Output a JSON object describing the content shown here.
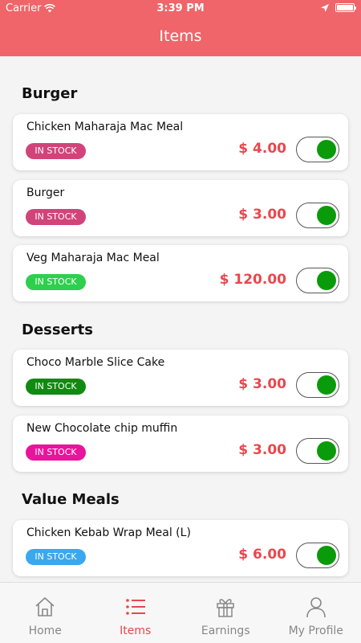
{
  "status_bar": {
    "carrier": "Carrier",
    "time": "3:39 PM"
  },
  "header": {
    "title": "Items"
  },
  "colors": {
    "accent": "#ef6569",
    "price": "#e9474d",
    "toggle_on": "#0a9b0a"
  },
  "sections": [
    {
      "title": "Burger",
      "items": [
        {
          "name": "Chicken Maharaja Mac Meal",
          "badge": "IN STOCK",
          "badge_color": "#d1447a",
          "price": "$ 4.00",
          "enabled": true
        },
        {
          "name": "Burger",
          "badge": "IN STOCK",
          "badge_color": "#d1447a",
          "price": "$ 3.00",
          "enabled": true
        },
        {
          "name": "Veg Maharaja Mac Meal",
          "badge": "IN STOCK",
          "badge_color": "#2ecf4c",
          "price": "$ 120.00",
          "enabled": true
        }
      ]
    },
    {
      "title": "Desserts",
      "items": [
        {
          "name": "Choco Marble Slice Cake",
          "badge": "IN STOCK",
          "badge_color": "#108a10",
          "price": "$ 3.00",
          "enabled": true
        },
        {
          "name": "New Chocolate chip muffin",
          "badge": "IN STOCK",
          "badge_color": "#e8149a",
          "price": "$ 3.00",
          "enabled": true
        }
      ]
    },
    {
      "title": "Value Meals",
      "items": [
        {
          "name": "Chicken Kebab Wrap Meal (L)",
          "badge": "IN STOCK",
          "badge_color": "#3aa8ee",
          "price": "$ 6.00",
          "enabled": true
        }
      ]
    }
  ],
  "tabs": [
    {
      "label": "Home",
      "icon": "home-icon",
      "active": false
    },
    {
      "label": "Items",
      "icon": "list-icon",
      "active": true
    },
    {
      "label": "Earnings",
      "icon": "gift-icon",
      "active": false
    },
    {
      "label": "My Profile",
      "icon": "user-icon",
      "active": false
    }
  ]
}
